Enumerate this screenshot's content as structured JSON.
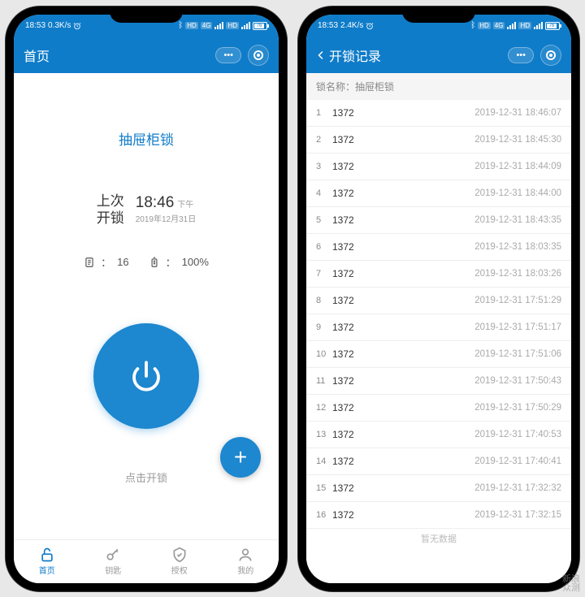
{
  "colors": {
    "primary": "#0f7cc9",
    "accent": "#1d87cf"
  },
  "left": {
    "status": {
      "time": "18:53",
      "speed": "0.3K/s",
      "battery": "76"
    },
    "header": {
      "title": "首页"
    },
    "lock_name": "抽屉柜锁",
    "last_unlock": {
      "label_line1": "上次",
      "label_line2": "开锁",
      "time": "18:46",
      "ampm": "下午",
      "date": "2019年12月31日"
    },
    "stats": {
      "count": "16",
      "battery": "100%"
    },
    "unlock_hint": "点击开锁",
    "tabs": [
      {
        "label": "首页",
        "icon": "lock"
      },
      {
        "label": "钥匙",
        "icon": "key"
      },
      {
        "label": "授权",
        "icon": "shield"
      },
      {
        "label": "我的",
        "icon": "user"
      }
    ]
  },
  "right": {
    "status": {
      "time": "18:53",
      "speed": "2.4K/s",
      "battery": "76"
    },
    "header": {
      "title": "开锁记录"
    },
    "lock_label_prefix": "锁名称：",
    "lock_label_value": "抽屉柜锁",
    "no_data": "暂无数据",
    "records": [
      {
        "idx": "1",
        "id": "1372",
        "time": "2019-12-31 18:46:07"
      },
      {
        "idx": "2",
        "id": "1372",
        "time": "2019-12-31 18:45:30"
      },
      {
        "idx": "3",
        "id": "1372",
        "time": "2019-12-31 18:44:09"
      },
      {
        "idx": "4",
        "id": "1372",
        "time": "2019-12-31 18:44:00"
      },
      {
        "idx": "5",
        "id": "1372",
        "time": "2019-12-31 18:43:35"
      },
      {
        "idx": "6",
        "id": "1372",
        "time": "2019-12-31 18:03:35"
      },
      {
        "idx": "7",
        "id": "1372",
        "time": "2019-12-31 18:03:26"
      },
      {
        "idx": "8",
        "id": "1372",
        "time": "2019-12-31 17:51:29"
      },
      {
        "idx": "9",
        "id": "1372",
        "time": "2019-12-31 17:51:17"
      },
      {
        "idx": "10",
        "id": "1372",
        "time": "2019-12-31 17:51:06"
      },
      {
        "idx": "11",
        "id": "1372",
        "time": "2019-12-31 17:50:43"
      },
      {
        "idx": "12",
        "id": "1372",
        "time": "2019-12-31 17:50:29"
      },
      {
        "idx": "13",
        "id": "1372",
        "time": "2019-12-31 17:40:53"
      },
      {
        "idx": "14",
        "id": "1372",
        "time": "2019-12-31 17:40:41"
      },
      {
        "idx": "15",
        "id": "1372",
        "time": "2019-12-31 17:32:32"
      },
      {
        "idx": "16",
        "id": "1372",
        "time": "2019-12-31 17:32:15"
      }
    ]
  },
  "watermark": {
    "line1": "新浪",
    "line2": "众测"
  }
}
